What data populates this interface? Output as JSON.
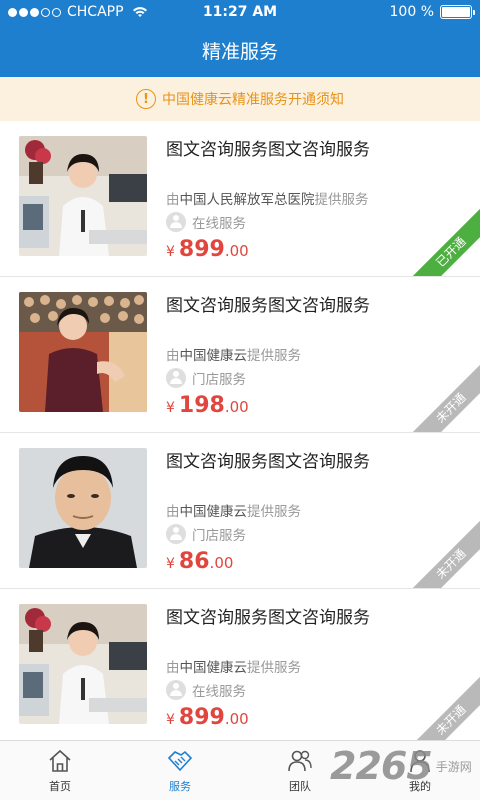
{
  "status": {
    "carrier": "CHCAPP",
    "time": "11:27 AM",
    "battery": "100 %"
  },
  "header": {
    "title": "精准服务"
  },
  "notice": {
    "icon": "exclamation-circle-icon",
    "text": "中国健康云精准服务开通须知"
  },
  "cards": [
    {
      "title": "图文咨询服务图文咨询服务",
      "provider_prefix": "由",
      "provider_name": "中国人民解放军总医院",
      "provider_suffix": "提供服务",
      "service_type": "在线服务",
      "currency": "¥",
      "price_int": "899",
      "price_dec": ".00",
      "ribbon": "已开通",
      "status_color": "#4caf3f"
    },
    {
      "title": "图文咨询服务图文咨询服务",
      "provider_prefix": "由",
      "provider_name": "中国健康云",
      "provider_suffix": "提供服务",
      "service_type": "门店服务",
      "currency": "¥",
      "price_int": "198",
      "price_dec": ".00",
      "ribbon": "未开通",
      "status_color": "#b9b9b9"
    },
    {
      "title": "图文咨询服务图文咨询服务",
      "provider_prefix": "由",
      "provider_name": "中国健康云",
      "provider_suffix": "提供服务",
      "service_type": "门店服务",
      "currency": "¥",
      "price_int": "86",
      "price_dec": ".00",
      "ribbon": "未开通",
      "status_color": "#b9b9b9"
    },
    {
      "title": "图文咨询服务图文咨询服务",
      "provider_prefix": "由",
      "provider_name": "中国健康云",
      "provider_suffix": "提供服务",
      "service_type": "在线服务",
      "currency": "¥",
      "price_int": "899",
      "price_dec": ".00",
      "ribbon": "未开通",
      "status_color": "#b9b9b9"
    }
  ],
  "tabs": [
    {
      "label": "首页",
      "icon": "home-icon"
    },
    {
      "label": "服务",
      "icon": "handshake-icon",
      "active": true
    },
    {
      "label": "团队",
      "icon": "team-icon"
    },
    {
      "label": "我的",
      "icon": "user-icon"
    }
  ],
  "watermark": {
    "number": "2265",
    "suffix": "手游网"
  },
  "colors": {
    "primary": "#1f7fcf",
    "price": "#e0463e",
    "notice": "#e8931a"
  }
}
